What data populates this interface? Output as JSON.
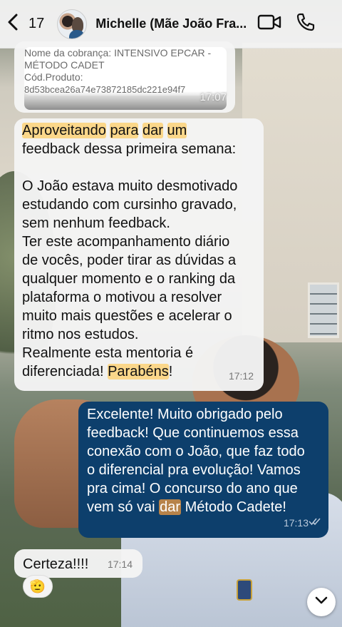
{
  "header": {
    "unread_count": "17",
    "contact_name": "Michelle (Mãe João Fra..."
  },
  "messages": {
    "payment_card": {
      "charge_label": "Nome da cobrança: INTENSIVO EPCAR -",
      "charge_label_cont": "MÉTODO CADET",
      "product_label": "Cód.Produto:",
      "product_code": "8d53bcea26a74e73872185dc221e94f7",
      "time": "17:07"
    },
    "feedback": {
      "hl_1": "Aproveitando",
      "hl_2": "para",
      "hl_3": "dar",
      "hl_4": "um",
      "line_2": "feedback dessa primeira semana:",
      "line_4": "O João estava muito desmotivado",
      "line_5": "estudando com cursinho gravado,",
      "line_6": "sem nenhum feedback.",
      "line_7": "Ter este acompanhamento diário",
      "line_8": "de vocês, poder tirar as dúvidas a",
      "line_9": "qualquer momento e o ranking da",
      "line_10": "plataforma o motivou a resolver",
      "line_11": "muito mais questões e acelerar o",
      "line_12": "ritmo nos estudos.",
      "line_13": "Realmente esta mentoria é",
      "line_14_pre": "diferenciada!",
      "line_14_hl": "Parabéns",
      "line_14_post": "!",
      "time": "17:12"
    },
    "reply": {
      "line_1": "Excelente! Muito obrigado pelo",
      "line_2": "feedback! Que continuemos essa",
      "line_3": "conexão com o João, que faz todo",
      "line_4": "o diferencial pra evolução! Vamos",
      "line_5": "pra cima! O concurso do ano que",
      "line_6_pre": "vem só vai",
      "line_6_hl": "dar",
      "line_6_post": "Método Cadete!",
      "time": "17:13"
    },
    "short": {
      "text": "Certeza!!!!",
      "time": "17:14",
      "reaction": "🫡"
    }
  },
  "colors": {
    "outgoing_bubble": "#0d3f6c",
    "incoming_bubble": "#f4f4f4",
    "highlight": "#fbd78a"
  },
  "icons": [
    "back-chevron-icon",
    "video-call-icon",
    "phone-icon",
    "read-ticks-icon",
    "chevron-down-icon"
  ]
}
